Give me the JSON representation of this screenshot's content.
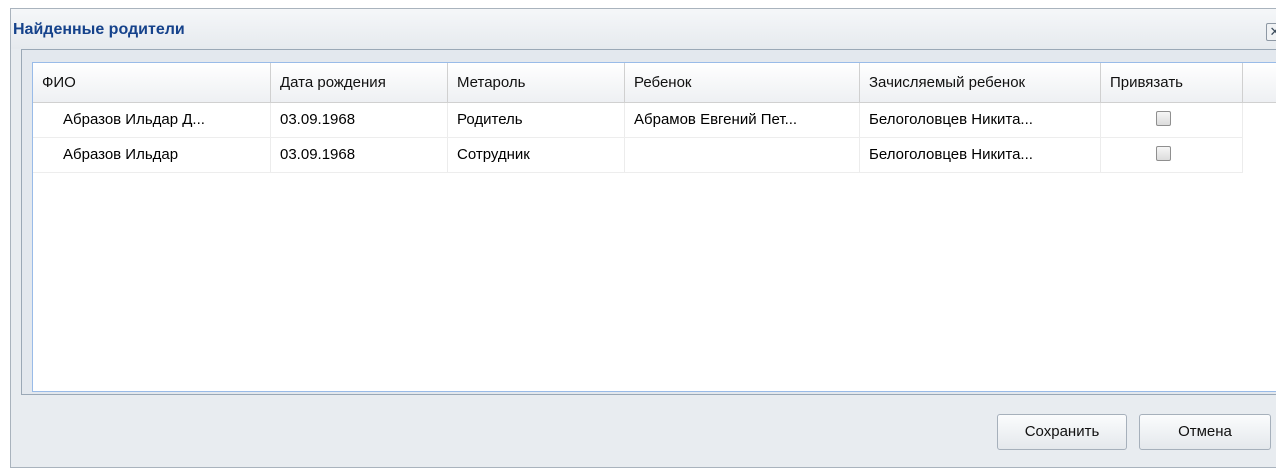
{
  "window": {
    "title": "Найденные родители",
    "close_glyph": "✕"
  },
  "grid": {
    "columns": [
      "ФИО",
      "Дата рождения",
      "Метароль",
      "Ребенок",
      "Зачисляемый ребенок",
      "Привязать"
    ],
    "rows": [
      {
        "fio": "Абразов Ильдар Д...",
        "birth_date": "03.09.1968",
        "metarole": "Родитель",
        "child": "Абрамов Евгений Пет...",
        "enrolled_child": "Белоголовцев Никита...",
        "bind_checked": false
      },
      {
        "fio": "Абразов Ильдар",
        "birth_date": "03.09.1968",
        "metarole": "Сотрудник",
        "child": "",
        "enrolled_child": "Белоголовцев Никита...",
        "bind_checked": false
      }
    ]
  },
  "buttons": {
    "save_label": "Сохранить",
    "cancel_label": "Отмена"
  },
  "icons": {
    "close": "close-icon",
    "checkbox": "checkbox-unchecked-icon"
  },
  "colors": {
    "title": "#15428b",
    "grid_border": "#99bbe8",
    "window_bg": "#e8ecf0"
  }
}
